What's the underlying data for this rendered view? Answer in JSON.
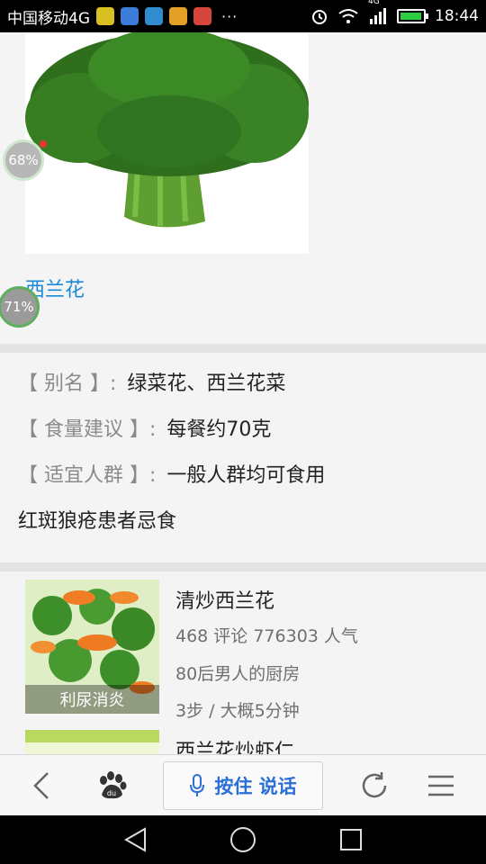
{
  "status_bar": {
    "carrier": "中国移动4G",
    "more": "···",
    "network_badge": "4G",
    "time": "18:44",
    "battery_level": 0.95
  },
  "floating_badges": [
    "68%",
    "71%"
  ],
  "food": {
    "title": "西兰花"
  },
  "info": {
    "alias_key": "【 别名 】:",
    "alias_value": "绿菜花、西兰花菜",
    "amount_key": "【 食量建议 】:",
    "amount_value": "每餐约70克",
    "suitable_key": "【 适宜人群 】:",
    "suitable_value": "一般人群均可食用",
    "warning": "红斑狼疮患者忌食"
  },
  "recipes": [
    {
      "title": "清炒西兰花",
      "stats": "468 评论 776303 人气",
      "author": "80后男人的厨房",
      "steps": "3步 / 大概5分钟",
      "tag": "利尿消炎"
    },
    {
      "title": "西兰花炒虾仁"
    }
  ],
  "bottom_bar": {
    "voice_label": "按住 说话"
  },
  "colors": {
    "accent_link": "#1a8ad8",
    "voice_blue": "#2a6fd6"
  }
}
